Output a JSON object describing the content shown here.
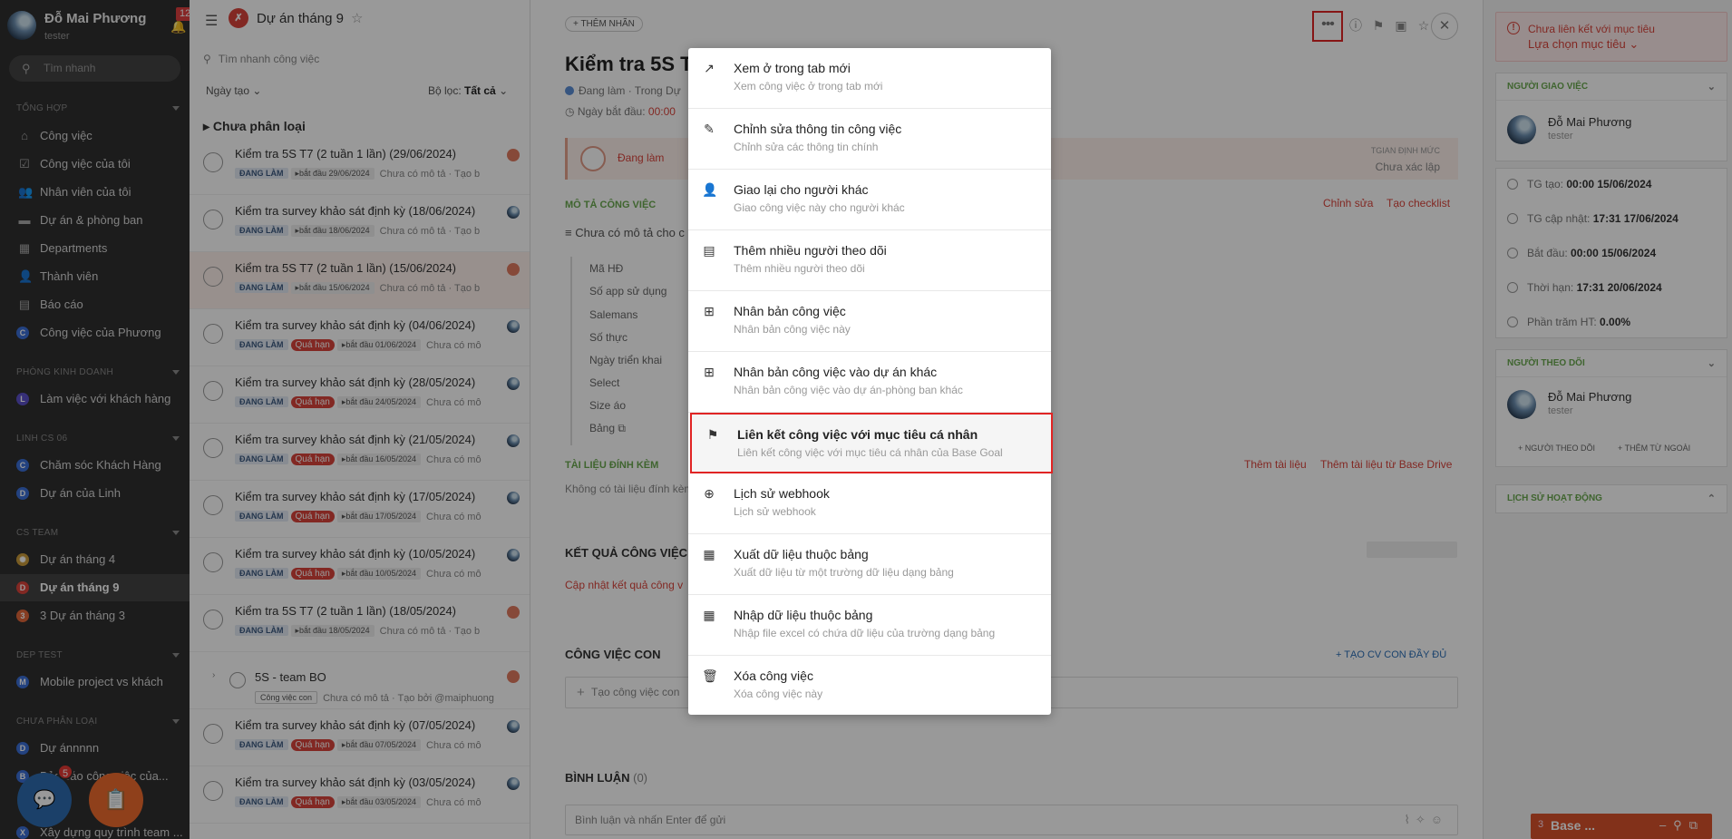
{
  "sidebar": {
    "user_name": "Đỗ Mai Phương",
    "user_role": "tester",
    "notif_count": "12",
    "search_placeholder": "Tìm nhanh",
    "sections": [
      {
        "label": "TỔNG HỢP"
      },
      {
        "label": "PHÒNG KINH DOANH"
      },
      {
        "label": "LINH CS 06"
      },
      {
        "label": "CS TEAM"
      },
      {
        "label": "DEP TEST"
      },
      {
        "label": "CHƯA PHÂN LOẠI"
      }
    ],
    "items": [
      {
        "label": "Công việc",
        "icon": "home-icon"
      },
      {
        "label": "Công việc của tôi",
        "icon": "checkbox-icon"
      },
      {
        "label": "Nhân viên của tôi",
        "icon": "users-icon"
      },
      {
        "label": "Dự án & phòng ban",
        "icon": "folder-icon"
      },
      {
        "label": "Departments",
        "icon": "building-icon"
      },
      {
        "label": "Thành viên",
        "icon": "user-add-icon"
      },
      {
        "label": "Báo cáo",
        "icon": "chart-icon"
      },
      {
        "label": "Công việc của Phương",
        "letter": "C",
        "color": "#3b6fd6"
      },
      {
        "label": "Làm việc với khách hàng",
        "letter": "L",
        "color": "#5b4fc7"
      },
      {
        "label": "Chăm sóc Khách Hàng",
        "letter": "C",
        "color": "#3b6fd6"
      },
      {
        "label": "Dự án của Linh",
        "letter": "D",
        "color": "#3b6fd6"
      },
      {
        "label": "Dự án tháng 4",
        "letter": "",
        "color": "#c89a3a"
      },
      {
        "label": "Dự án tháng 9",
        "letter": "D",
        "color": "#d9443b"
      },
      {
        "label": "3 Dự án tháng 3",
        "letter": "3",
        "color": "#e0663a"
      },
      {
        "label": "Mobile project vs khách",
        "letter": "M",
        "color": "#3b6fd6"
      },
      {
        "label": "Dự ánnnnn",
        "letter": "D",
        "color": "#3b6fd6"
      },
      {
        "label": "Bảo cáo công việc của...",
        "letter": "B",
        "color": "#3b6fd6"
      },
      {
        "label": "Xây dựng quy trình team ...",
        "letter": "X",
        "color": "#3b6fd6"
      }
    ],
    "chat_badge": "5"
  },
  "list": {
    "project_title": "Dự án tháng 9",
    "quick_search": "Tìm nhanh công việc",
    "sort_label": "Ngày tạo",
    "filter_label": "Bộ lọc:",
    "filter_value": "Tất cả",
    "group_title": "Chưa phân loại",
    "rows": [
      {
        "title": "Kiểm tra 5S T7 (2 tuần 1 lần) (29/06/2024)",
        "status": "ĐANG LÀM",
        "late": "",
        "start": "bắt đầu 29/06/2024",
        "desc": "Chưa có mô tả · Tạo b"
      },
      {
        "title": "Kiểm tra survey khảo sát định kỳ (18/06/2024)",
        "status": "ĐANG LÀM",
        "late": "",
        "start": "bắt đầu 18/06/2024",
        "desc": "Chưa có mô tả · Tạo b"
      },
      {
        "title": "Kiểm tra 5S T7 (2 tuần 1 lần) (15/06/2024)",
        "status": "ĐANG LÀM",
        "late": "",
        "start": "bắt đầu 15/06/2024",
        "desc": "Chưa có mô tả · Tạo b"
      },
      {
        "title": "Kiểm tra survey khảo sát định kỳ (04/06/2024)",
        "status": "ĐANG LÀM",
        "late": "Quá hạn",
        "start": "bắt đầu 01/06/2024",
        "desc": "Chưa có mô"
      },
      {
        "title": "Kiểm tra survey khảo sát định kỳ (28/05/2024)",
        "status": "ĐANG LÀM",
        "late": "Quá hạn",
        "start": "bắt đầu 24/05/2024",
        "desc": "Chưa có mô"
      },
      {
        "title": "Kiểm tra survey khảo sát định kỳ (21/05/2024)",
        "status": "ĐANG LÀM",
        "late": "Quá hạn",
        "start": "bắt đầu 16/05/2024",
        "desc": "Chưa có mô"
      },
      {
        "title": "Kiểm tra survey khảo sát định kỳ (17/05/2024)",
        "status": "ĐANG LÀM",
        "late": "Quá hạn",
        "start": "bắt đầu 17/05/2024",
        "desc": "Chưa có mô"
      },
      {
        "title": "Kiểm tra survey khảo sát định kỳ (10/05/2024)",
        "status": "ĐANG LÀM",
        "late": "Quá hạn",
        "start": "bắt đầu 10/05/2024",
        "desc": "Chưa có mô"
      },
      {
        "title": "Kiểm tra 5S T7 (2 tuần 1 lần) (18/05/2024)",
        "status": "ĐANG LÀM",
        "late": "",
        "start": "bắt đầu 18/05/2024",
        "desc": "Chưa có mô tả · Tạo b"
      },
      {
        "title": "5S - team BO",
        "status": "Công việc con",
        "late": "",
        "start": "",
        "desc": "Chưa có mô tả · Tạo bởi @maiphuong"
      },
      {
        "title": "Kiểm tra survey khảo sát định kỳ (07/05/2024)",
        "status": "ĐANG LÀM",
        "late": "Quá hạn",
        "start": "bắt đầu 07/05/2024",
        "desc": "Chưa có mô"
      },
      {
        "title": "Kiểm tra survey khảo sát định kỳ (03/05/2024)",
        "status": "ĐANG LÀM",
        "late": "Quá hạn",
        "start": "bắt đầu 03/05/2024",
        "desc": "Chưa có mô"
      }
    ]
  },
  "detail": {
    "add_tag": "+ THÊM NHÃN",
    "title": "Kiểm tra 5S T7",
    "status_line": "Đang làm · Trong Dự",
    "date_label": "Ngày bắt đầu:",
    "date_value": "00:00",
    "status_card_label": "Đang làm",
    "norm_label": "TGIAN ĐỊNH MỨC",
    "norm_value": "Chưa xác lập",
    "desc_section": "MÔ TẢ CÔNG VIỆC",
    "desc_edit": "Chỉnh sửa",
    "desc_checklist": "Tạo checklist",
    "desc_text": "Chưa có mô tả cho c",
    "fields": [
      "Mã HĐ",
      "Số app sử dụng",
      "Salemans",
      "Số thực",
      "Ngày triển khai",
      "Select",
      "Size áo",
      "Bảng"
    ],
    "att_section": "TÀI LIỆU ĐÍNH KÈM",
    "att_add": "Thêm tài liệu",
    "att_add_drive": "Thêm tài liệu từ Base Drive",
    "att_empty": "Không có tài liệu đính kèm",
    "result_section": "KẾT QUẢ CÔNG VIỆC",
    "result_link": "Cập nhật kết quả công v",
    "sub_section": "CÔNG VIỆC CON",
    "sub_full": "TẠO CV CON ĐẦY ĐỦ",
    "sub_placeholder": "Tạo công việc con",
    "comment_section": "BÌNH LUẬN",
    "comment_count": "(0)",
    "comment_placeholder": "Bình luận và nhấn Enter để gửi"
  },
  "right": {
    "warn_text": "Chưa liên kết với mục tiêu",
    "warn_link": "Lựa chọn mục tiêu",
    "assigner_title": "NGƯỜI GIAO VIỆC",
    "assigner_name": "Đỗ Mai Phương",
    "assigner_role": "tester",
    "info": [
      {
        "label": "TG tạo:",
        "value": "00:00 15/06/2024"
      },
      {
        "label": "TG cập nhật:",
        "value": "17:31 17/06/2024"
      },
      {
        "label": "Bắt đầu:",
        "value": "00:00 15/06/2024"
      },
      {
        "label": "Thời hạn:",
        "value": "17:31 20/06/2024"
      },
      {
        "label": "Phần trăm HT:",
        "value": "0.00%"
      }
    ],
    "followers_title": "NGƯỜI THEO DÕI",
    "follower_name": "Đỗ Mai Phương",
    "follower_role": "tester",
    "add_follower": "NGƯỜI THEO DÕI",
    "add_external": "THÊM TỪ NGOÀI",
    "history_title": "LỊCH SỬ HOẠT ĐỘNG",
    "base_count": "3",
    "base_label": "Base ..."
  },
  "menu": {
    "items": [
      {
        "title": "Xem ở trong tab mới",
        "sub": "Xem công việc ở trong tab mới",
        "icon": "external-link-icon"
      },
      {
        "title": "Chỉnh sửa thông tin công việc",
        "sub": "Chỉnh sửa các thông tin chính",
        "icon": "pencil-icon"
      },
      {
        "title": "Giao lại cho người khác",
        "sub": "Giao công việc này cho người khác",
        "icon": "person-icon"
      },
      {
        "title": "Thêm nhiều người theo dõi",
        "sub": "Thêm nhiều người theo dõi",
        "icon": "contacts-icon"
      },
      {
        "title": "Nhân bản công việc",
        "sub": "Nhân bản công việc này",
        "icon": "plus-box-icon"
      },
      {
        "title": "Nhân bản công việc vào dự án khác",
        "sub": "Nhân bản công việc vào dự án-phòng ban khác",
        "icon": "plus-box-icon"
      },
      {
        "title": "Liên kết công việc với mục tiêu cá nhân",
        "sub": "Liên kết công việc với mục tiêu cá nhân của Base Goal",
        "icon": "flag-icon"
      },
      {
        "title": "Lịch sử webhook",
        "sub": "Lịch sử webhook",
        "icon": "globe-icon"
      },
      {
        "title": "Xuất dữ liệu thuộc bảng",
        "sub": "Xuất dữ liệu từ một trường dữ liệu dạng bảng",
        "icon": "table-icon"
      },
      {
        "title": "Nhập dữ liệu thuộc bảng",
        "sub": "Nhập file excel có chứa dữ liệu của trường dạng bảng",
        "icon": "table-icon"
      },
      {
        "title": "Xóa công việc",
        "sub": "Xóa công việc này",
        "icon": "trash-icon"
      }
    ]
  }
}
